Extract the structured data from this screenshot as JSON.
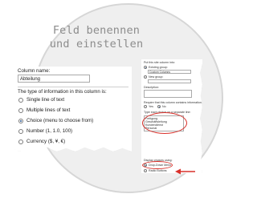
{
  "title": {
    "line1": "Feld benennen",
    "line2": "und einstellen"
  },
  "left_panel": {
    "column_name_label": "Column name:",
    "column_name_value": "Abteilung",
    "type_label": "The type of information in this column is:",
    "options": [
      {
        "label": "Single line of text",
        "selected": false
      },
      {
        "label": "Multiple lines of text",
        "selected": false
      },
      {
        "label": "Choice (menu to choose from)",
        "selected": true
      },
      {
        "label": "Number (1, 1.0, 100)",
        "selected": false
      },
      {
        "label": "Currency ($, ¥, €)",
        "selected": false
      }
    ]
  },
  "right_panel": {
    "group_header": "Put this site column into:",
    "existing_group_label": "Existing group:",
    "existing_group_value": "Custom Columns",
    "new_group_label": "New group:",
    "description_label": "Description:",
    "require_label": "Require that this column contains information:",
    "yes_label": "Yes",
    "no_label": "No",
    "choices_label": "Type each choice on a separate line:",
    "choices": [
      "Fertigung",
      "Geschäftsleitung",
      "Kundendienst",
      "Personal"
    ],
    "display_label": "Display choices using:",
    "display_options": [
      {
        "label": "Drop-Down Menu",
        "selected": true
      },
      {
        "label": "Radio Buttons",
        "selected": false
      }
    ]
  },
  "colors": {
    "highlight": "#d9302a",
    "title_text": "#8c8c8c",
    "circle_bg": "#efefef"
  }
}
